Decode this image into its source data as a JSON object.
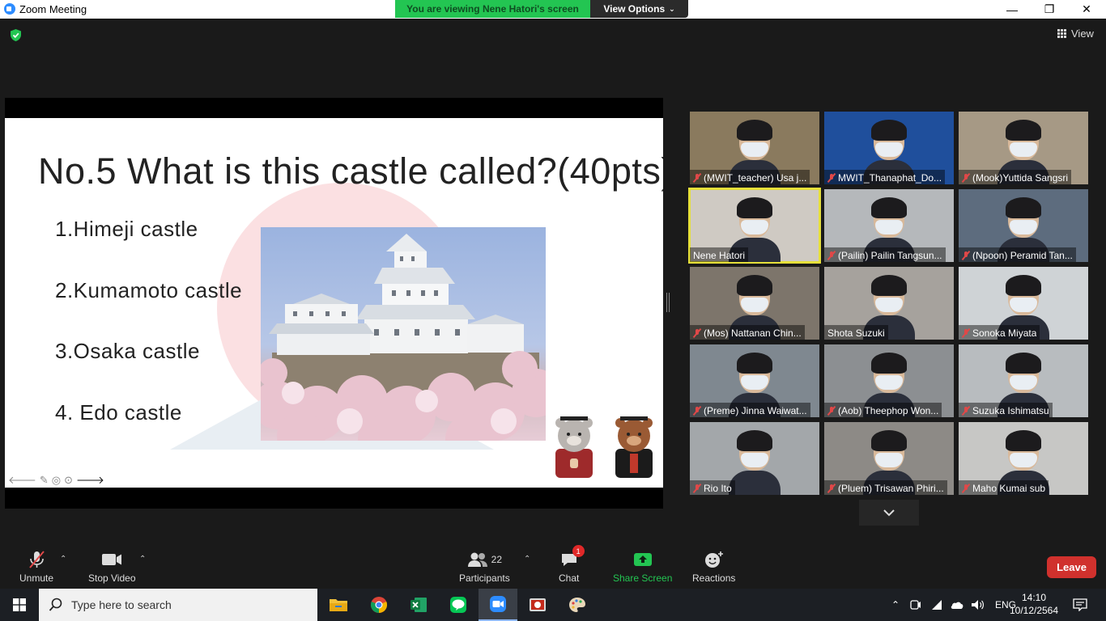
{
  "window": {
    "title": "Zoom Meeting",
    "minimize": "—",
    "maximize": "❐",
    "close": "✕"
  },
  "banner": {
    "prefix": "You are viewing ",
    "presenter": "Nene Hatori's",
    "suffix": " screen",
    "view_options": "View Options"
  },
  "top": {
    "view_label": "View"
  },
  "slide": {
    "title": "No.5 What is this castle called?(40pts)",
    "options": [
      "1.Himeji castle",
      "2.Kumamoto castle",
      "3.Osaka castle",
      "4. Edo castle"
    ]
  },
  "participants_grid": [
    {
      "name": "(MWIT_teacher) Usa j...",
      "muted": true
    },
    {
      "name": "MWIT_Thanaphat_Do...",
      "muted": true
    },
    {
      "name": "(Mook)Yuttida Sangsri",
      "muted": true
    },
    {
      "name": "Nene Hatori",
      "muted": false,
      "active": true
    },
    {
      "name": "(Pailin) Pailin Tangsun...",
      "muted": true
    },
    {
      "name": "(Npoon) Peramid Tan...",
      "muted": true
    },
    {
      "name": "(Mos) Nattanan Chin...",
      "muted": true
    },
    {
      "name": "Shota Suzuki",
      "muted": false
    },
    {
      "name": "Sonoka Miyata",
      "muted": true
    },
    {
      "name": "(Preme) Jinna Waiwat...",
      "muted": true
    },
    {
      "name": "(Aob) Theephop Won...",
      "muted": true
    },
    {
      "name": "Suzuka Ishimatsu",
      "muted": true
    },
    {
      "name": "Rio Ito",
      "muted": true
    },
    {
      "name": "(Pluem) Trisawan Phiri...",
      "muted": true
    },
    {
      "name": "Maho Kumai sub",
      "muted": true
    }
  ],
  "toolbar": {
    "unmute": "Unmute",
    "stop_video": "Stop Video",
    "participants": "Participants",
    "participants_count": "22",
    "chat": "Chat",
    "chat_badge": "1",
    "share_screen": "Share Screen",
    "reactions": "Reactions",
    "leave": "Leave"
  },
  "taskbar": {
    "search_placeholder": "Type here to search",
    "lang": "ENG",
    "time": "14:10",
    "date": "10/12/2564"
  },
  "colors": {
    "banner_green": "#23c552",
    "leave_red": "#d0312d",
    "share_green": "#23c552",
    "active_speaker": "#e6e03a"
  }
}
